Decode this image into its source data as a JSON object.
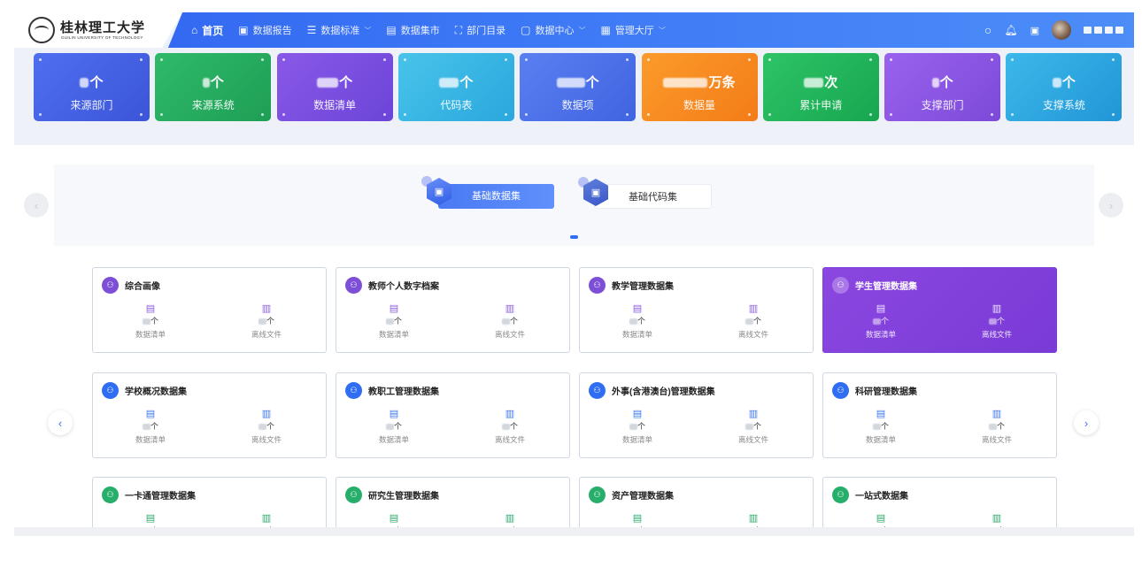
{
  "header": {
    "logo_text": "桂林理工大学",
    "logo_sub": "GUILIN UNIVERSITY OF TECHNOLOGY",
    "nav": [
      {
        "label": "首页",
        "icon": "⌂",
        "icon_name": "home-icon",
        "active": true,
        "dropdown": false
      },
      {
        "label": "数据报告",
        "icon": "▣",
        "icon_name": "report-icon",
        "active": false,
        "dropdown": false
      },
      {
        "label": "数据标准",
        "icon": "☰",
        "icon_name": "standard-icon",
        "active": false,
        "dropdown": true
      },
      {
        "label": "数据集市",
        "icon": "▤",
        "icon_name": "market-icon",
        "active": false,
        "dropdown": false
      },
      {
        "label": "部门目录",
        "icon": "⛶",
        "icon_name": "directory-icon",
        "active": false,
        "dropdown": false
      },
      {
        "label": "数据中心",
        "icon": "▢",
        "icon_name": "data-center-icon",
        "active": false,
        "dropdown": true
      },
      {
        "label": "管理大厅",
        "icon": "▦",
        "icon_name": "admin-icon",
        "active": false,
        "dropdown": true
      }
    ]
  },
  "stats": [
    {
      "value_suffix": "个",
      "blur_w": 10,
      "label": "来源部门",
      "color_a": "#4f6ff0",
      "color_b": "#3c55d8"
    },
    {
      "value_suffix": "个",
      "blur_w": 8,
      "label": "来源系统",
      "color_a": "#2fba6a",
      "color_b": "#1e9e55"
    },
    {
      "value_suffix": "个",
      "blur_w": 24,
      "label": "数据清单",
      "color_a": "#8a58e8",
      "color_b": "#6b45d8"
    },
    {
      "value_suffix": "个",
      "blur_w": 22,
      "label": "代码表",
      "color_a": "#48c4ea",
      "color_b": "#2aa7dd"
    },
    {
      "value_suffix": "个",
      "blur_w": 32,
      "label": "数据项",
      "color_a": "#5a7ff2",
      "color_b": "#4064e0"
    },
    {
      "value_suffix": "万条",
      "blur_w": 50,
      "label": "数据量",
      "color_a": "#fb9b2b",
      "color_b": "#f47c18"
    },
    {
      "value_suffix": "次",
      "blur_w": 22,
      "label": "累计申请",
      "color_a": "#2ec466",
      "color_b": "#17a650"
    },
    {
      "value_suffix": "个",
      "blur_w": 8,
      "label": "支撑部门",
      "color_a": "#9a62ee",
      "color_b": "#7c4ad8"
    },
    {
      "value_suffix": "个",
      "blur_w": 10,
      "label": "支撑系统",
      "color_a": "#3cb8ea",
      "color_b": "#2196d6"
    }
  ],
  "categories": [
    {
      "label": "基础数据集",
      "active": true
    },
    {
      "label": "基础代码集",
      "active": false
    }
  ],
  "datasets": [
    {
      "title": "综合画像",
      "theme": "purple",
      "highlight": false
    },
    {
      "title": "教师个人数字档案",
      "theme": "purple",
      "highlight": false
    },
    {
      "title": "教学管理数据集",
      "theme": "purple",
      "highlight": false
    },
    {
      "title": "学生管理数据集",
      "theme": "purple",
      "highlight": true
    },
    {
      "title": "学校概况数据集",
      "theme": "blue",
      "highlight": false
    },
    {
      "title": "教职工管理数据集",
      "theme": "blue",
      "highlight": false
    },
    {
      "title": "外事(含港澳台)管理数据集",
      "theme": "blue",
      "highlight": false
    },
    {
      "title": "科研管理数据集",
      "theme": "blue",
      "highlight": false
    },
    {
      "title": "一卡通管理数据集",
      "theme": "green",
      "highlight": false
    },
    {
      "title": "研究生管理数据集",
      "theme": "green",
      "highlight": false
    },
    {
      "title": "资产管理数据集",
      "theme": "green",
      "highlight": false
    },
    {
      "title": "一站式数据集",
      "theme": "green",
      "highlight": false
    }
  ],
  "dataset_fields": {
    "list_label": "数据清单",
    "file_label": "离线文件",
    "unit": "个"
  },
  "icons": {
    "search": "○",
    "bell": "♫",
    "save": "▣",
    "prev": "‹",
    "next": "›"
  }
}
